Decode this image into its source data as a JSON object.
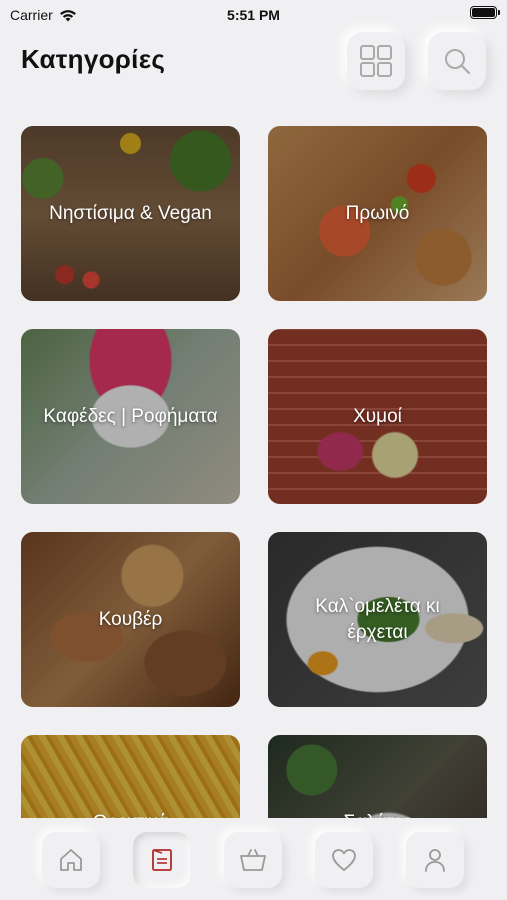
{
  "status_bar": {
    "carrier": "Carrier",
    "time": "5:51 PM"
  },
  "header": {
    "title": "Κατηγορίες",
    "grid_icon": "grid-icon",
    "search_icon": "search-icon"
  },
  "categories": [
    {
      "label": "Νηστίσιμα & Vegan"
    },
    {
      "label": "Πρωινό"
    },
    {
      "label": "Καφέδες | Ροφήματα"
    },
    {
      "label": "Χυμοί"
    },
    {
      "label": "Κουβέρ"
    },
    {
      "label": "Καλ`ομελέτα κι έρχεται"
    },
    {
      "label": "Ορεκτικά"
    },
    {
      "label": "Σαλάτες"
    }
  ],
  "tabbar": {
    "items": [
      {
        "icon": "home-icon",
        "active": false
      },
      {
        "icon": "menu-icon",
        "active": true
      },
      {
        "icon": "basket-icon",
        "active": false
      },
      {
        "icon": "heart-icon",
        "active": false
      },
      {
        "icon": "user-icon",
        "active": false
      }
    ]
  },
  "colors": {
    "background": "#f0f0f2",
    "active_icon": "#b22a2a",
    "inactive_icon": "#9a9a9a"
  }
}
